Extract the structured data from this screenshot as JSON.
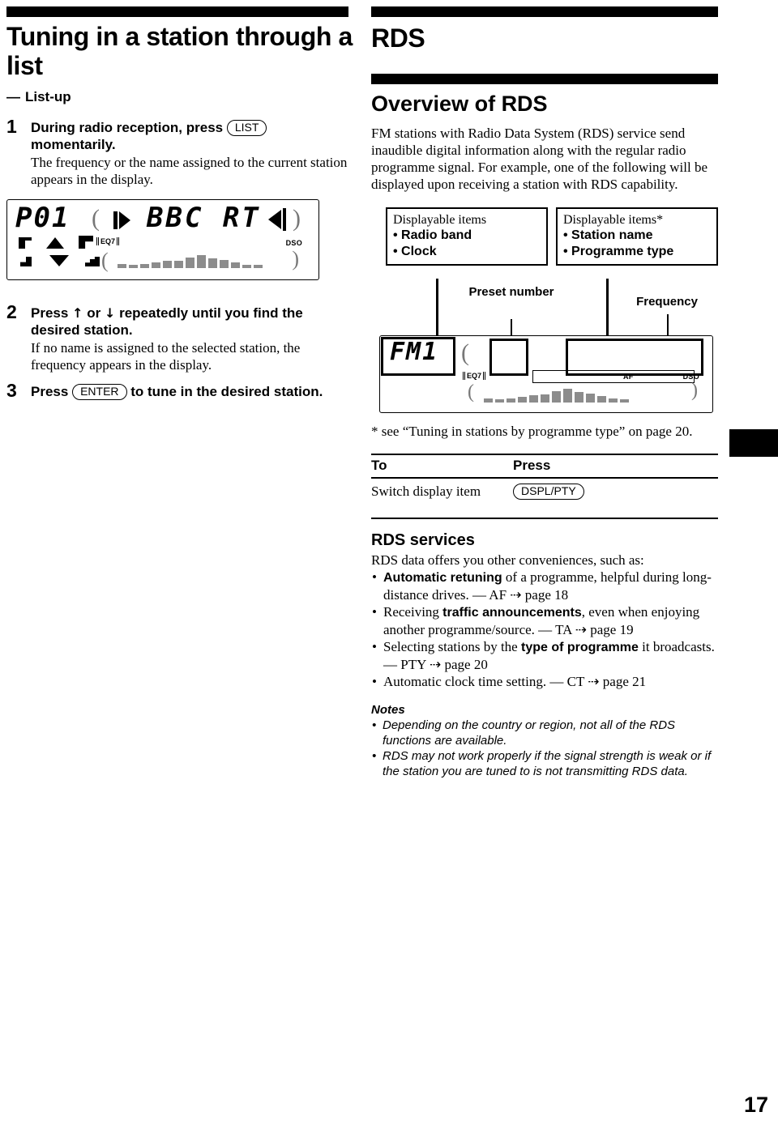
{
  "page": {
    "number": "17"
  },
  "left": {
    "chapter_title": "Tuning in a station through a list",
    "subtitle_dash": "—",
    "subtitle": "List-up",
    "steps": [
      {
        "num": "1",
        "head_before": "During radio reception, press",
        "key": "LIST",
        "head_after": "momentarily.",
        "body": "The frequency or the name assigned to the current station appears in the display."
      },
      {
        "num": "2",
        "head_before": "Press",
        "arrow_up": "↑",
        "head_mid": "or",
        "arrow_down": "↓",
        "head_after": "repeatedly until you find the desired station.",
        "body": "If no name is assigned to the selected station, the frequency appears in the display."
      },
      {
        "num": "3",
        "head_before": "Press",
        "key": "ENTER",
        "head_after": "to tune in the desired station.",
        "body": ""
      }
    ],
    "display": {
      "preset": "P01",
      "station_text": "BBC RT",
      "eq_label": "EQ7",
      "dso_label": "DSO"
    }
  },
  "right": {
    "chapter_title": "RDS",
    "section_title": "Overview of RDS",
    "intro": "FM stations with Radio Data System (RDS) service send inaudible digital information along with the regular radio programme signal. For example, one of the following will be displayed upon receiving a station with RDS capability.",
    "callouts": {
      "left_box": {
        "title": "Displayable items",
        "items": [
          "Radio band",
          "Clock"
        ]
      },
      "right_box": {
        "title": "Displayable items*",
        "items": [
          "Station name",
          "Programme type"
        ]
      },
      "preset_label": "Preset number",
      "frequency_label": "Frequency"
    },
    "display": {
      "band": "FM1",
      "eq_label": "EQ7",
      "af_label": "AF",
      "dso_label": "DSO"
    },
    "footnote": "* see “Tuning in stations by programme type” on page 20.",
    "table": {
      "headers": [
        "To",
        "Press"
      ],
      "rows": [
        {
          "to": "Switch display item",
          "press_key": "DSPL/PTY"
        }
      ]
    },
    "services": {
      "title": "RDS services",
      "lead": "RDS data offers you other conveniences, such as:",
      "bullets": [
        {
          "pre": "",
          "bold": "Automatic retuning",
          "post": " of a programme, helpful during long-distance drives. — AF ⇢ page 18"
        },
        {
          "pre": "Receiving ",
          "bold": "traffic announcements",
          "post": ", even when enjoying another programme/source. — TA ⇢ page 19"
        },
        {
          "pre": "Selecting stations by the ",
          "bold": "type of programme",
          "post": " it broadcasts. — PTY ⇢ page 20"
        },
        {
          "pre": "Automatic clock time setting. — CT ⇢ page 21",
          "bold": "",
          "post": ""
        }
      ]
    },
    "notes": {
      "title": "Notes",
      "items": [
        "Depending on the country or region, not all of the RDS functions are available.",
        "RDS may not work properly if the signal strength is weak or if the station you are tuned to is not transmitting RDS data."
      ]
    }
  }
}
